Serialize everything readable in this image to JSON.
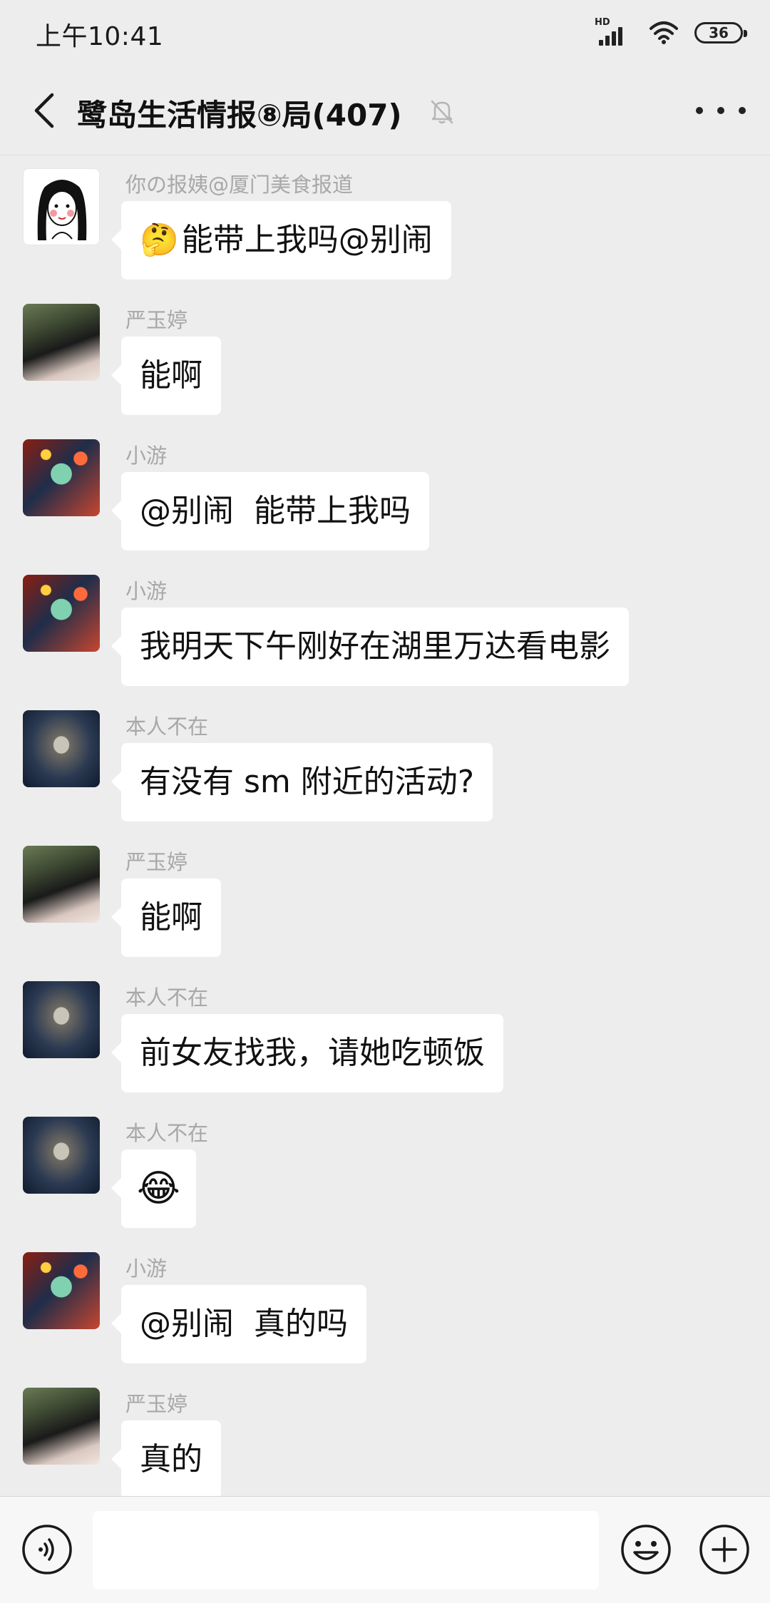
{
  "status_bar": {
    "time": "上午10:41",
    "network": "HD",
    "battery": "36"
  },
  "header": {
    "title": "鹭岛生活情报⑧局(407)",
    "icons": [
      "back-icon",
      "mute-bell-icon",
      "more-icon"
    ]
  },
  "messages": [
    {
      "sender": "你の报姨@厦门美食报道",
      "avatar": "drawing",
      "emoji": "🤔",
      "text": "能带上我吗@别闹"
    },
    {
      "sender": "严玉婷",
      "avatar": "photo",
      "emoji": "",
      "text": "能啊"
    },
    {
      "sender": "小游",
      "avatar": "anime",
      "emoji": "",
      "text": "@别闹  能带上我吗"
    },
    {
      "sender": "小游",
      "avatar": "anime",
      "emoji": "",
      "text": "我明天下午刚好在湖里万达看电影"
    },
    {
      "sender": "本人不在",
      "avatar": "wolf",
      "emoji": "",
      "text": "有没有 sm 附近的活动?"
    },
    {
      "sender": "严玉婷",
      "avatar": "photo",
      "emoji": "",
      "text": "能啊"
    },
    {
      "sender": "本人不在",
      "avatar": "wolf",
      "emoji": "",
      "text": "前女友找我，请她吃顿饭"
    },
    {
      "sender": "本人不在",
      "avatar": "wolf",
      "emoji": "😂",
      "text": ""
    },
    {
      "sender": "小游",
      "avatar": "anime",
      "emoji": "",
      "text": "@别闹  真的吗"
    },
    {
      "sender": "严玉婷",
      "avatar": "photo",
      "emoji": "",
      "text": "真的"
    }
  ],
  "input_bar": {
    "value": "",
    "icons": [
      "voice-icon",
      "emoji-icon",
      "plus-icon"
    ]
  }
}
